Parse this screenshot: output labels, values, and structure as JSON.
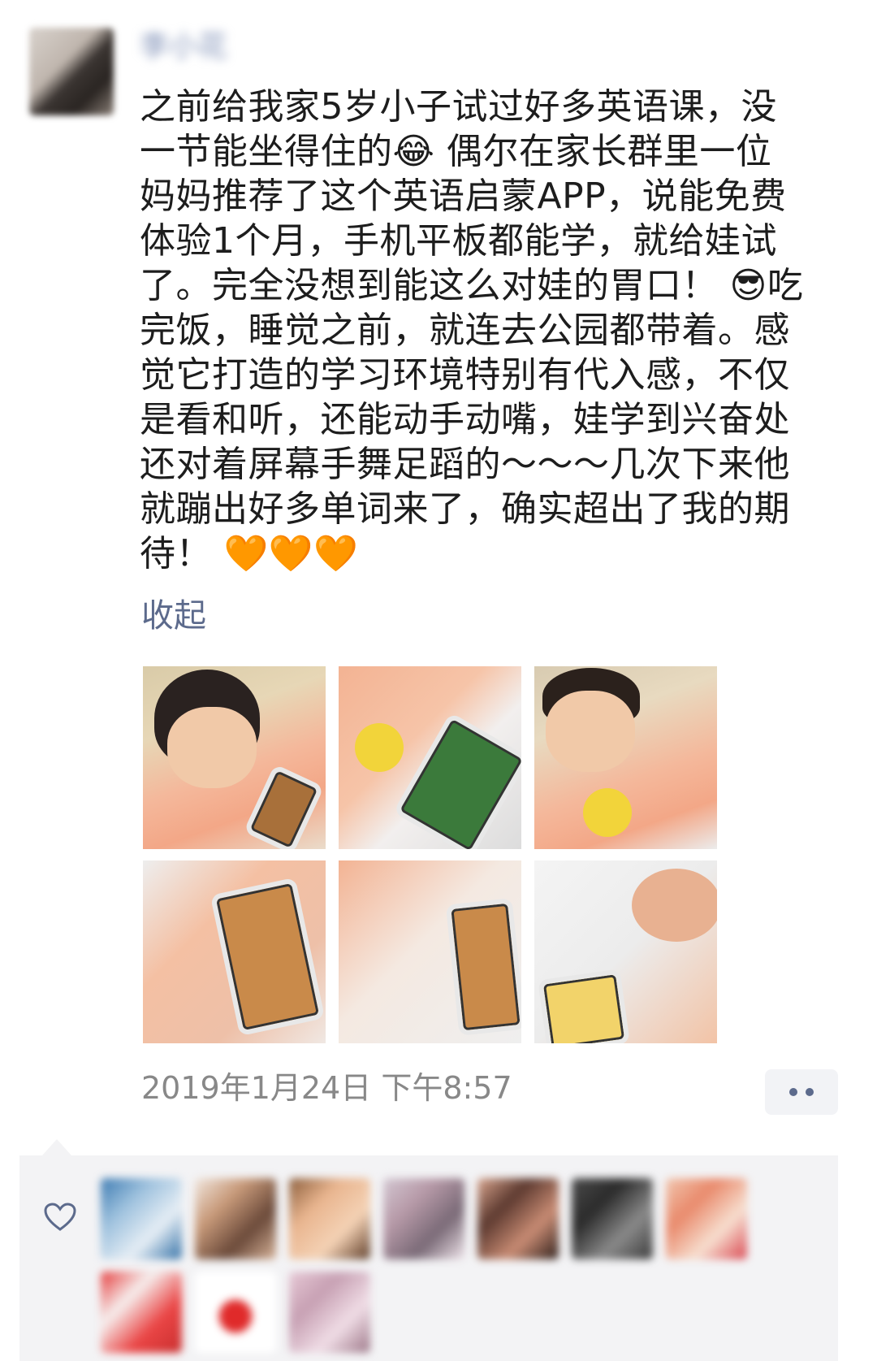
{
  "post": {
    "username": "李小花",
    "text_before_laugh": "之前给我家5岁小子试过好多英语课，没一节能坐得住的",
    "text_after_laugh": " 偶尔在家长群里一位妈妈推荐了这个英语启蒙APP，说能免费体验1个月，手机平板都能学，就给娃试了。完全没想到能这么对娃的胃口！ ",
    "text_after_cool": "吃完饭，睡觉之前，就连去公园都带着。感觉它打造的学习环境特别有代入感，不仅是看和听，还能动手动嘴，娃学到兴奋处还对着屏幕手舞足蹈的～～～几次下来他就蹦出好多单词来了，确实超出了我的期待！ ",
    "emoji_laugh": "😂",
    "emoji_cool": "😎",
    "emoji_hearts": "🧡🧡🧡",
    "collapse_label": "收起",
    "timestamp": "2019年1月24日 下午8:57"
  },
  "icons": {
    "more": "more-dots-icon",
    "like": "heart-outline-icon"
  },
  "colors": {
    "link": "#5c6a8c",
    "timestamp": "#888888",
    "likes_bg": "#f3f3f5",
    "heart": "#f06a26"
  }
}
